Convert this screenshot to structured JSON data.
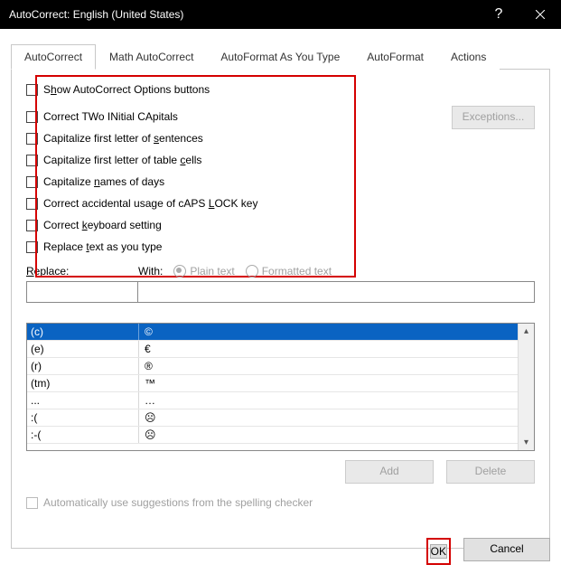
{
  "title": "AutoCorrect: English (United States)",
  "tabs": [
    "AutoCorrect",
    "Math AutoCorrect",
    "AutoFormat As You Type",
    "AutoFormat",
    "Actions"
  ],
  "active_tab": 0,
  "checkboxes": {
    "show_options": "Show AutoCorrect Options buttons",
    "two_initial": "Correct TWo INitial CApitals",
    "first_sentence": "Capitalize first letter of sentences",
    "first_table": "Capitalize first letter of table cells",
    "names_days": "Capitalize names of days",
    "caps_lock": "Correct accidental usage of cAPS LOCK key",
    "keyboard": "Correct keyboard setting",
    "replace_type": "Replace text as you type"
  },
  "exceptions_label": "Exceptions...",
  "replace_label": "Replace:",
  "with_label": "With:",
  "plain_label": "Plain text",
  "formatted_label": "Formatted text",
  "list_rows": [
    {
      "a": "(c)",
      "b": "©"
    },
    {
      "a": "(e)",
      "b": "€"
    },
    {
      "a": "(r)",
      "b": "®"
    },
    {
      "a": "(tm)",
      "b": "™"
    },
    {
      "a": "...",
      "b": "…"
    },
    {
      "a": ":(",
      "b": "☹"
    },
    {
      "a": ":-(",
      "b": "☹"
    }
  ],
  "selected_row": 0,
  "add_label": "Add",
  "delete_label": "Delete",
  "auto_suggestions_label": "Automatically use suggestions from the spelling checker",
  "ok_label": "OK",
  "cancel_label": "Cancel"
}
